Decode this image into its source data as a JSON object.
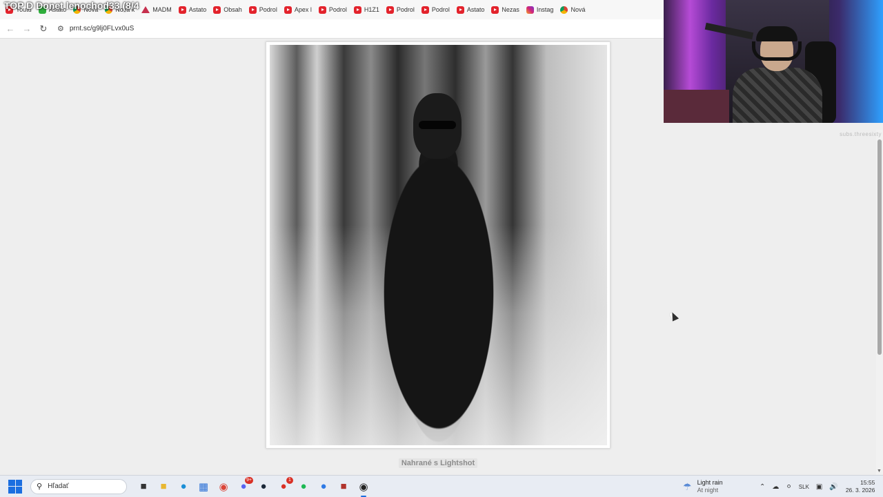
{
  "stream_overlay": "TOP D Donet lenochod33 (8/4",
  "bookmarks": [
    {
      "label": "Youtu",
      "icon": "youtube-icon"
    },
    {
      "label": "Astato",
      "icon": "green-app-icon"
    },
    {
      "label": "Nová",
      "icon": "chrome-icon"
    },
    {
      "label": "Nová k",
      "icon": "chrome-icon"
    },
    {
      "label": "MADM",
      "icon": "madm-icon"
    },
    {
      "label": "Astato",
      "icon": "youtube-icon"
    },
    {
      "label": "Obsah",
      "icon": "youtube-icon"
    },
    {
      "label": "Podrol",
      "icon": "youtube-icon"
    },
    {
      "label": "Apex l",
      "icon": "youtube-icon"
    },
    {
      "label": "Podrol",
      "icon": "youtube-icon"
    },
    {
      "label": "H1Z1",
      "icon": "youtube-icon"
    },
    {
      "label": "Podrol",
      "icon": "youtube-icon"
    },
    {
      "label": "Podrol",
      "icon": "youtube-icon"
    },
    {
      "label": "Astato",
      "icon": "youtube-icon"
    },
    {
      "label": "Nezas",
      "icon": "youtube-icon"
    },
    {
      "label": "Instag",
      "icon": "instagram-icon"
    },
    {
      "label": "Nová",
      "icon": "chrome-icon"
    }
  ],
  "address_bar": {
    "url": "prnt.sc/g9lj0FLvx0uS"
  },
  "page": {
    "caption": "Nahrané s Lightshot"
  },
  "webcam": {
    "caption": "subs.threesixty"
  },
  "taskbar": {
    "search_placeholder": "Hľadať",
    "apps": [
      {
        "name": "task-view",
        "icon": "task-view-icon"
      },
      {
        "name": "file-explorer",
        "icon": "folder-icon"
      },
      {
        "name": "edge",
        "icon": "edge-icon"
      },
      {
        "name": "store",
        "icon": "store-icon"
      },
      {
        "name": "chrome",
        "icon": "chrome-icon"
      },
      {
        "name": "discord",
        "icon": "discord-icon",
        "badge": "9+"
      },
      {
        "name": "steam",
        "icon": "steam-icon"
      },
      {
        "name": "app-red",
        "icon": "red-app-icon",
        "badge": "1"
      },
      {
        "name": "spotify",
        "icon": "spotify-icon"
      },
      {
        "name": "app-blue",
        "icon": "blue-app-icon"
      },
      {
        "name": "game",
        "icon": "game-icon"
      },
      {
        "name": "obs",
        "icon": "obs-icon"
      }
    ],
    "weather": {
      "title": "Light rain",
      "subtitle": "At night"
    },
    "language": "SLK",
    "time": "15:55",
    "date": "26. 3. 2026"
  },
  "colors": {
    "accent": "#1b6ee0",
    "youtube": "#e3232c",
    "background": "#eeeeee"
  }
}
